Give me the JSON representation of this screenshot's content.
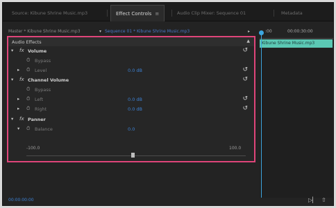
{
  "tabs": [
    {
      "label": "Source: Kibune Shrine Music.mp3",
      "active": false
    },
    {
      "label": "Effect Controls",
      "active": true,
      "close": "≡"
    },
    {
      "label": "Audio Clip Mixer: Sequence 01",
      "active": false
    },
    {
      "label": "Metadata",
      "active": false
    }
  ],
  "clip_header": {
    "master_label": "Master * Kibune Shrine Music.mp3",
    "sequence_label": "Sequence 01 * Kibune Shrine Music.mp3"
  },
  "timeline": {
    "start_tc": ":00",
    "end_tc": "00:00:30:00",
    "clip_name": "Kibune Shrine Music.mp3",
    "accent_color": "#3da6e0",
    "clip_color": "#5bc8b4"
  },
  "panel": {
    "title": "Audio Effects",
    "highlight_color": "#e0457a"
  },
  "effects": [
    {
      "name": "Volume",
      "bypass": "Bypass",
      "level_label": "Level",
      "level_value": "0.0 dB"
    },
    {
      "name": "Channel Volume",
      "bypass": "Bypass",
      "left_label": "Left",
      "left_value": "0.0 dB",
      "right_label": "Right",
      "right_value": "0.0 dB"
    },
    {
      "name": "Panner",
      "balance_label": "Balance",
      "balance_value": "0.0",
      "min": "-100.0",
      "max": "100.0"
    }
  ],
  "icons": {
    "expand_open": "▾",
    "expand_closed": "▸",
    "fx": "fx",
    "stopwatch": "⏱",
    "reset": "↺",
    "collapse": "▲",
    "dropdown": "▾",
    "next": "▸"
  },
  "footer": {
    "timecode": "00:00:00:00",
    "play_only_icon": "▷▏",
    "export_icon": "⇧"
  }
}
